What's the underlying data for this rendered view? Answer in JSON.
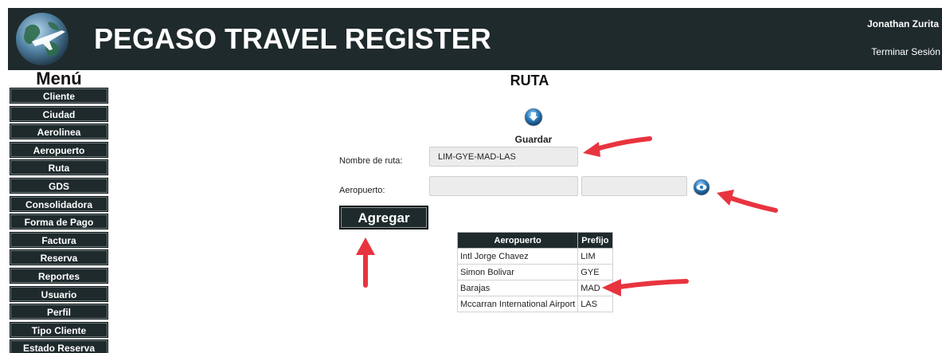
{
  "header": {
    "brand": "PEGASO TRAVEL REGISTER",
    "user_name": "Jonathan Zurita",
    "logout": "Terminar Sesión"
  },
  "menu": {
    "title": "Menú",
    "items": [
      {
        "label": "Cliente"
      },
      {
        "label": "Ciudad"
      },
      {
        "label": "Aerolinea"
      },
      {
        "label": "Aeropuerto"
      },
      {
        "label": "Ruta"
      },
      {
        "label": "GDS"
      },
      {
        "label": "Consolidadora"
      },
      {
        "label": "Forma de Pago"
      },
      {
        "label": "Factura"
      },
      {
        "label": "Reserva"
      },
      {
        "label": "Reportes"
      },
      {
        "label": "Usuario"
      },
      {
        "label": "Perfil"
      },
      {
        "label": "Tipo Cliente"
      },
      {
        "label": "Estado Reserva"
      }
    ]
  },
  "main": {
    "title": "RUTA",
    "save_label": "Guardar",
    "route_label": "Nombre de ruta:",
    "route_value": "LIM-GYE-MAD-LAS",
    "airport_label": "Aeropuerto:",
    "airport_value": "",
    "airport_code_value": "",
    "add_button": "Agregar",
    "table": {
      "headers": [
        "Aeropuerto",
        "Prefijo"
      ],
      "rows": [
        [
          "Intl Jorge Chavez",
          "LIM"
        ],
        [
          "Simon Bolivar",
          "GYE"
        ],
        [
          "Barajas",
          "MAD"
        ],
        [
          "Mccarran International Airport",
          "LAS"
        ]
      ]
    }
  },
  "colors": {
    "header_bg": "#1f2a2c",
    "accent_arrow": "#e8343f",
    "icon_blue": "#2f7fc1"
  }
}
